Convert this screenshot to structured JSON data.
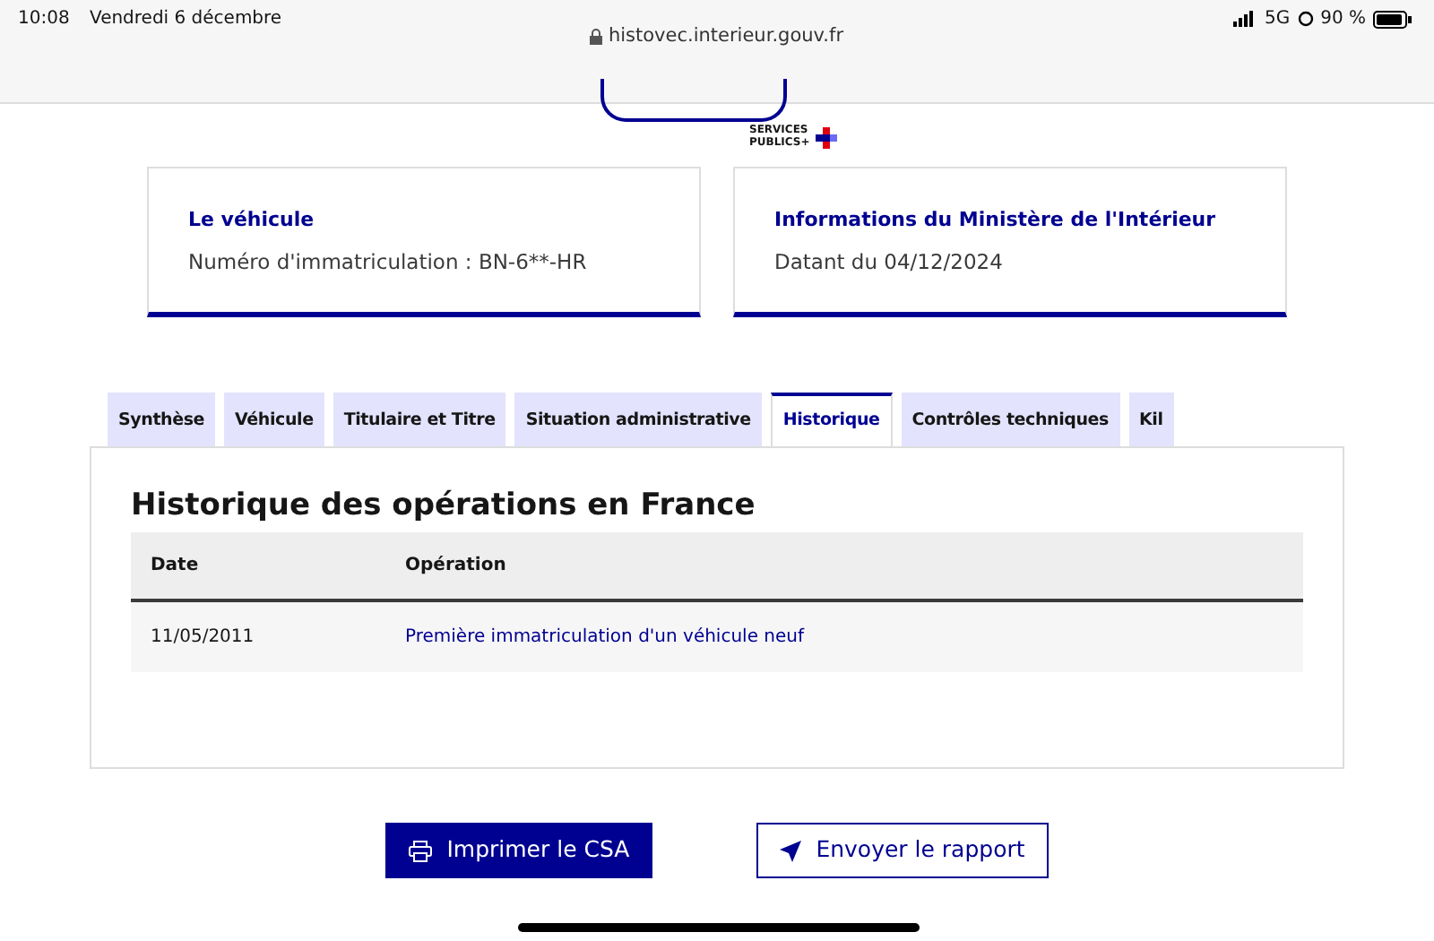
{
  "status_bar": {
    "time": "10:08",
    "date": "Vendredi 6 décembre",
    "network": "5G",
    "battery": "90 %"
  },
  "browser": {
    "url": "histovec.interieur.gouv.fr"
  },
  "header": {
    "logo_line_1": "SERVICES",
    "logo_line_2": "PUBLICS+"
  },
  "cards": [
    {
      "title": "Le véhicule",
      "text": "Numéro d'immatriculation : BN-6**-HR"
    },
    {
      "title": "Informations du Ministère de l'Intérieur",
      "text": "Datant du 04/12/2024"
    }
  ],
  "tabs": [
    {
      "label": "Synthèse",
      "selected": false
    },
    {
      "label": "Véhicule",
      "selected": false
    },
    {
      "label": "Titulaire et Titre",
      "selected": false
    },
    {
      "label": "Situation administrative",
      "selected": false
    },
    {
      "label": "Historique",
      "selected": true
    },
    {
      "label": "Contrôles techniques",
      "selected": false
    },
    {
      "label": "Kil",
      "selected": false
    }
  ],
  "panel": {
    "title": "Historique des opérations en France",
    "table": {
      "columns": [
        "Date",
        "Opération"
      ],
      "rows": [
        {
          "date": "11/05/2011",
          "operation": "Première immatriculation d'un véhicule neuf"
        }
      ]
    }
  },
  "buttons": [
    {
      "label": "Imprimer le CSA",
      "kind": "primary"
    },
    {
      "label": "Envoyer le rapport",
      "kind": "secondary"
    }
  ]
}
